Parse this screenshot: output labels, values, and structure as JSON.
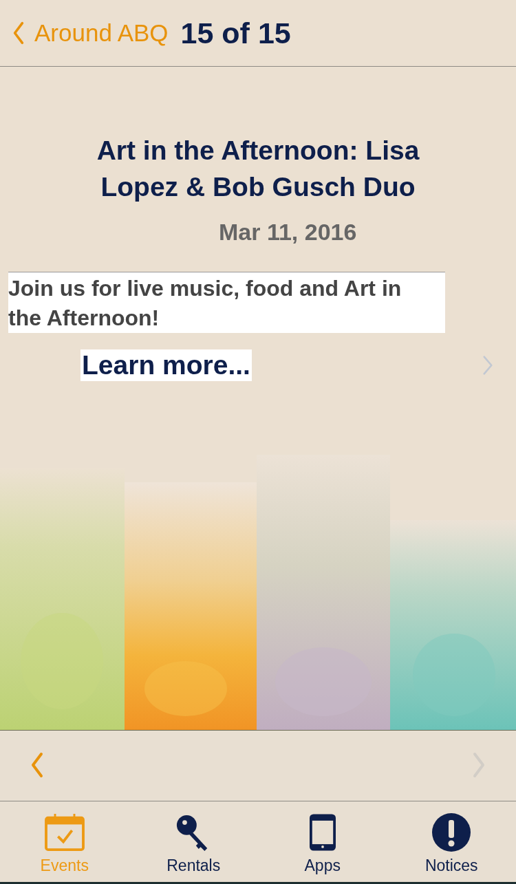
{
  "nav": {
    "back_label": "Around ABQ",
    "title": "15 of 15"
  },
  "event": {
    "title": "Art in the Afternoon: Lisa Lopez & Bob Gusch Duo",
    "date": "Mar 11, 2016",
    "description": "Join us for live music, food and Art in the Afternoon!",
    "link": "Learn more..."
  },
  "pager": {
    "previous_disabled": false,
    "next_disabled": true
  },
  "tabs": [
    {
      "label": "Events",
      "kind": "calendar",
      "selected": true
    },
    {
      "label": "Rentals",
      "kind": "key",
      "selected": false
    },
    {
      "label": "Apps",
      "kind": "phone",
      "selected": false
    },
    {
      "label": "Notices",
      "kind": "alert",
      "selected": false
    }
  ]
}
